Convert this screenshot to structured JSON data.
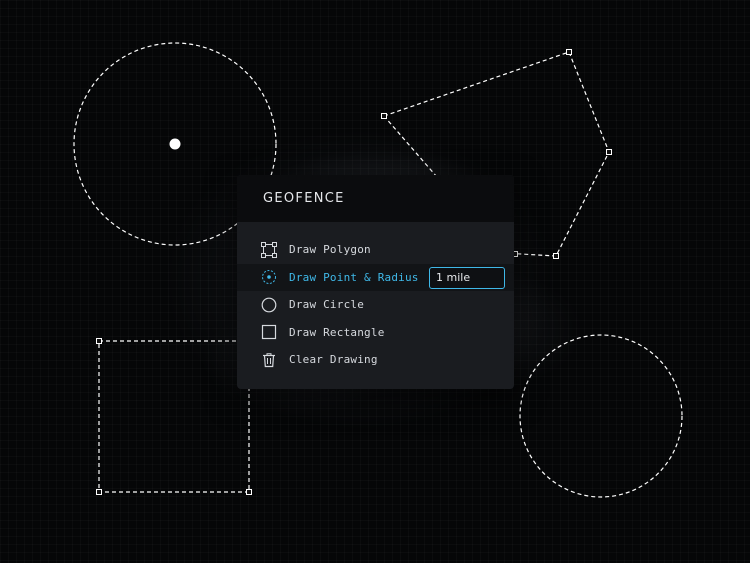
{
  "panel": {
    "title": "GEOFENCE",
    "items": [
      {
        "label": "Draw Polygon",
        "icon": "polygon-tool-icon",
        "active": false
      },
      {
        "label": "Draw Point & Radius",
        "icon": "point-radius-icon",
        "active": true
      },
      {
        "label": "Draw Circle",
        "icon": "circle-icon",
        "active": false
      },
      {
        "label": "Draw Rectangle",
        "icon": "rectangle-icon",
        "active": false
      },
      {
        "label": "Clear Drawing",
        "icon": "trash-icon",
        "active": false
      }
    ],
    "radius_input": {
      "value": "1 mile"
    }
  },
  "colors": {
    "accent": "#3fb8e8",
    "panel_bg": "#1a1c20",
    "header_bg": "#0b0c0e",
    "text": "#d6d9de",
    "shape_stroke": "#ffffff"
  }
}
